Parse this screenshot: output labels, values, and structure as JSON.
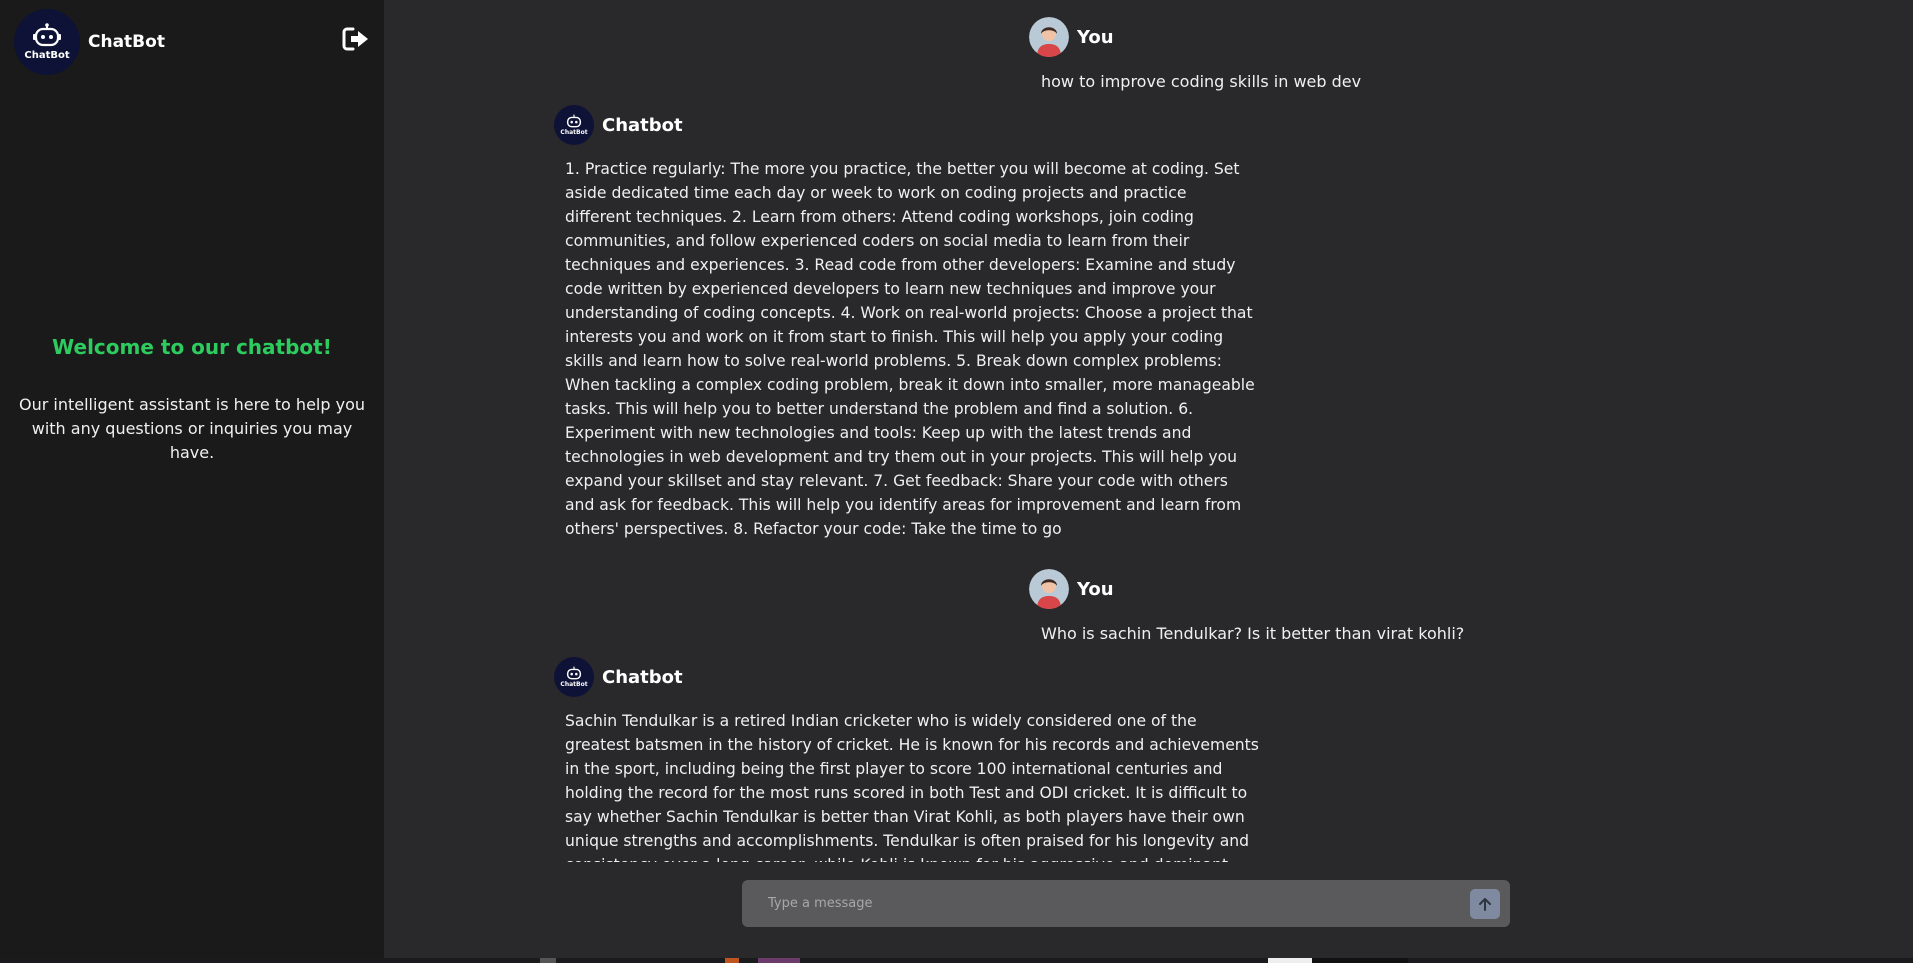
{
  "sidebar": {
    "brand_name": "ChatBot",
    "logo_text": "ChatBot",
    "welcome_title": "Welcome to our chatbot!",
    "welcome_text": "Our intelligent assistant is here to help you with any questions or inquiries you may have."
  },
  "messages": [
    {
      "sender": "You",
      "text": "how to improve coding skills in web dev"
    },
    {
      "sender": "Chatbot",
      "avatar_text": "ChatBot",
      "text": "1. Practice regularly: The more you practice, the better you will become at coding. Set aside dedicated time each day or week to work on coding projects and practice different techniques. 2. Learn from others: Attend coding workshops, join coding communities, and follow experienced coders on social media to learn from their techniques and experiences. 3. Read code from other developers: Examine and study code written by experienced developers to learn new techniques and improve your understanding of coding concepts. 4. Work on real-world projects: Choose a project that interests you and work on it from start to finish. This will help you apply your coding skills and learn how to solve real-world problems. 5. Break down complex problems: When tackling a complex coding problem, break it down into smaller, more manageable tasks. This will help you to better understand the problem and find a solution. 6. Experiment with new technologies and tools: Keep up with the latest trends and technologies in web development and try them out in your projects. This will help you expand your skillset and stay relevant. 7. Get feedback: Share your code with others and ask for feedback. This will help you identify areas for improvement and learn from others' perspectives. 8. Refactor your code: Take the time to go"
    },
    {
      "sender": "You",
      "text": "Who is sachin Tendulkar? Is it better than virat kohli?"
    },
    {
      "sender": "Chatbot",
      "avatar_text": "ChatBot",
      "text": "Sachin Tendulkar is a retired Indian cricketer who is widely considered one of the greatest batsmen in the history of cricket. He is known for his records and achievements in the sport, including being the first player to score 100 international centuries and holding the record for the most runs scored in both Test and ODI cricket. It is difficult to say whether Sachin Tendulkar is better than Virat Kohli, as both players have their own unique strengths and accomplishments. Tendulkar is often praised for his longevity and consistency over a long career, while Kohli is known for his aggressive and dominant batting style. Ultimately, it"
    }
  ],
  "input": {
    "placeholder": "Type a message"
  },
  "icons": {
    "logout": "logout-icon",
    "send": "arrow-up-icon",
    "user_avatar": "user-avatar-icon",
    "bot": "robot-icon"
  },
  "colors": {
    "accent_green": "#2dcc5e",
    "sidebar_bg": "#1a1a1b",
    "chat_bg": "#29292b",
    "logo_bg": "#0d1236"
  }
}
